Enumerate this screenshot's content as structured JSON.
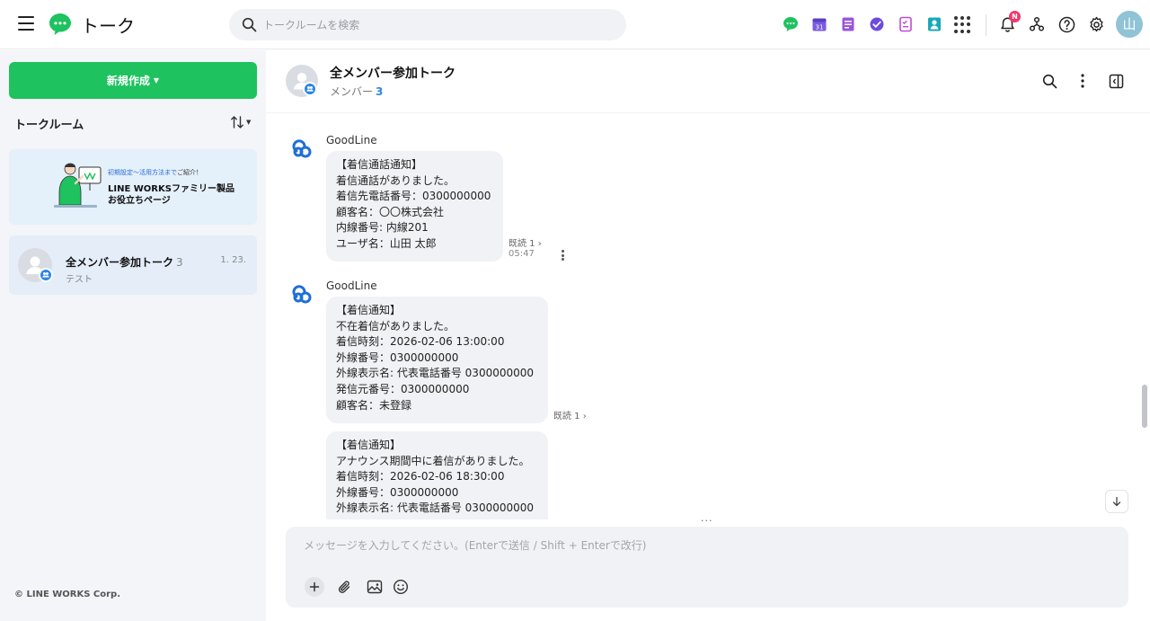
{
  "header": {
    "title": "トーク",
    "search_placeholder": "トークルームを検索",
    "notification_badge": "N",
    "user_avatar_initial": "山",
    "app_icons": [
      {
        "name": "talk-app-icon",
        "color": "#1ec25f"
      },
      {
        "name": "calendar-app-icon",
        "color": "#7b5be0",
        "label": "31"
      },
      {
        "name": "board-app-icon",
        "color": "#9a55d8"
      },
      {
        "name": "task-app-icon",
        "color": "#6c4be0"
      },
      {
        "name": "form-app-icon",
        "color": "#c04ad6"
      },
      {
        "name": "contacts-app-icon",
        "color": "#19a9b8"
      }
    ]
  },
  "sidebar": {
    "new_button_label": "新規作成",
    "rooms_label": "トークルーム",
    "banner": {
      "small_text_blue": "初期設定～活用方法まで",
      "small_text_dark": "ご紹介！",
      "line1": "LINE WORKSファミリー製品",
      "line2": "お役立ちページ"
    },
    "rooms": [
      {
        "name": "全メンバー参加トーク",
        "count": "3",
        "date": "1. 23.",
        "preview": "テスト"
      }
    ],
    "copyright": "© LINE WORKS Corp."
  },
  "chat": {
    "title": "全メンバー参加トーク",
    "members_label": "メンバー",
    "members_count": "3",
    "messages": [
      {
        "sender": "GoodLine",
        "text": "【着信通話通知】\n着信通話がありました。\n着信先電話番号：0300000000\n顧客名：〇〇株式会社\n内線番号: 内線201\nユーザ名：山田 太郎",
        "read": "既読 1 ›",
        "time": "05:47"
      },
      {
        "sender": "GoodLine",
        "text": "【着信通知】\n不在着信がありました。\n着信時刻：2026-02-06 13:00:00\n外線番号：0300000000\n外線表示名: 代表電話番号 0300000000\n発信元番号：0300000000\n顧客名：未登録",
        "read": "既読 1 ›"
      },
      {
        "sender": "",
        "text": "【着信通知】\nアナウンス期間中に着信がありました。\n着信時刻：2026-02-06 18:30:00\n外線番号：0300000000\n外線表示名: 代表電話番号 0300000000"
      }
    ],
    "resize_handle": "···",
    "composer_placeholder": "メッセージを入力してください。(Enterで送信 / Shift + Enterで改行)"
  },
  "colors": {
    "accent_green": "#1ec25f",
    "link_blue": "#2c86e8",
    "badge_red": "#f2376b"
  }
}
